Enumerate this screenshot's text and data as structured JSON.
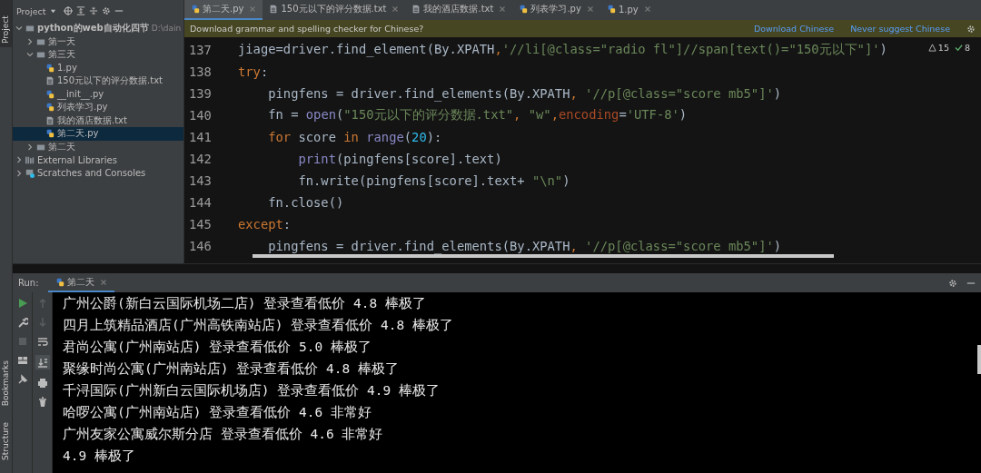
{
  "side_stripe": {
    "left_top": "Project",
    "left_bottom": [
      "Bookmarks",
      "Structure"
    ]
  },
  "project_panel": {
    "title": "Project",
    "tree": [
      {
        "label": "python的web自动化四节",
        "path": "D:\\dain",
        "kind": "folder",
        "expanded": true,
        "selected": false,
        "children": [
          {
            "label": "第一天",
            "kind": "folder",
            "expanded": false,
            "selected": false
          },
          {
            "label": "第三天",
            "kind": "folder",
            "expanded": true,
            "selected": false,
            "children": [
              {
                "label": "1.py",
                "kind": "py",
                "selected": false
              },
              {
                "label": "150元以下的评分数据.txt",
                "kind": "txt",
                "selected": false
              },
              {
                "label": "__init__.py",
                "kind": "py",
                "selected": false
              },
              {
                "label": "列表学习.py",
                "kind": "py",
                "selected": false
              },
              {
                "label": "我的酒店数据.txt",
                "kind": "txt",
                "selected": false
              },
              {
                "label": "第二天.py",
                "kind": "py",
                "selected": true
              }
            ]
          },
          {
            "label": "第二天",
            "kind": "folder",
            "expanded": false,
            "selected": false
          }
        ]
      },
      {
        "label": "External Libraries",
        "kind": "lib",
        "expanded": false,
        "selected": false
      },
      {
        "label": "Scratches and Consoles",
        "kind": "scratch",
        "expanded": false,
        "selected": false
      }
    ]
  },
  "editor_tabs": [
    {
      "label": "第二天.py",
      "kind": "py",
      "selected": true
    },
    {
      "label": "150元以下的评分数据.txt",
      "kind": "txt",
      "selected": false
    },
    {
      "label": "我的酒店数据.txt",
      "kind": "txt",
      "selected": false
    },
    {
      "label": "列表学习.py",
      "kind": "py",
      "selected": false
    },
    {
      "label": "1.py",
      "kind": "py",
      "selected": false
    }
  ],
  "notification": {
    "message": "Download grammar and spelling checker for Chinese?",
    "actions": [
      "Download Chinese",
      "Never suggest Chinese"
    ]
  },
  "inspections": {
    "warnings": "15",
    "ok": "8"
  },
  "code_lines": [
    {
      "number": "137",
      "tokens": [
        {
          "text": "jiage=driver.find_element(By.XPATH",
          "kind": "plain"
        },
        {
          "text": ",",
          "kind": "keyword"
        },
        {
          "text": "'//li[@class=\"radio fl\"]//span[text()=\"150元以下\"]'",
          "kind": "string"
        },
        {
          "text": ")",
          "kind": "plain"
        }
      ]
    },
    {
      "number": "138",
      "tokens": [
        {
          "text": "try",
          "kind": "keyword"
        },
        {
          "text": ":",
          "kind": "plain"
        }
      ]
    },
    {
      "number": "139",
      "tokens": [
        {
          "text": "    pingfens = driver.find_elements(By.XPATH",
          "kind": "plain"
        },
        {
          "text": ", ",
          "kind": "keyword"
        },
        {
          "text": "'//p[@class=\"score mb5\"]'",
          "kind": "string"
        },
        {
          "text": ")",
          "kind": "plain"
        }
      ]
    },
    {
      "number": "140",
      "tokens": [
        {
          "text": "    fn = ",
          "kind": "plain"
        },
        {
          "text": "open",
          "kind": "builtin"
        },
        {
          "text": "(",
          "kind": "plain"
        },
        {
          "text": "\"150元以下的评分数据.txt\"",
          "kind": "string"
        },
        {
          "text": ", ",
          "kind": "keyword"
        },
        {
          "text": "\"w\"",
          "kind": "string"
        },
        {
          "text": ",",
          "kind": "keyword"
        },
        {
          "text": "encoding",
          "kind": "param"
        },
        {
          "text": "=",
          "kind": "plain"
        },
        {
          "text": "'UTF-8'",
          "kind": "string"
        },
        {
          "text": ")",
          "kind": "plain"
        }
      ]
    },
    {
      "number": "141",
      "tokens": [
        {
          "text": "    for ",
          "kind": "keyword"
        },
        {
          "text": "score ",
          "kind": "plain"
        },
        {
          "text": "in ",
          "kind": "keyword"
        },
        {
          "text": "range",
          "kind": "builtin"
        },
        {
          "text": "(",
          "kind": "plain"
        },
        {
          "text": "20",
          "kind": "number"
        },
        {
          "text": "):",
          "kind": "plain"
        }
      ]
    },
    {
      "number": "142",
      "tokens": [
        {
          "text": "        print",
          "kind": "builtin"
        },
        {
          "text": "(pingfens[score].text)",
          "kind": "plain"
        }
      ]
    },
    {
      "number": "143",
      "tokens": [
        {
          "text": "        fn.write(pingfens[score].text+ ",
          "kind": "plain"
        },
        {
          "text": "\"\\n\"",
          "kind": "string"
        },
        {
          "text": ")",
          "kind": "plain"
        }
      ]
    },
    {
      "number": "144",
      "tokens": [
        {
          "text": "    fn.close()",
          "kind": "plain"
        }
      ]
    },
    {
      "number": "145",
      "tokens": [
        {
          "text": "except",
          "kind": "keyword"
        },
        {
          "text": ":",
          "kind": "plain"
        }
      ]
    },
    {
      "number": "146",
      "tokens": [
        {
          "text": "    pingfens = driver.find_elements(By.XPATH",
          "kind": "plain"
        },
        {
          "text": ", ",
          "kind": "keyword"
        },
        {
          "text": "'//p[@class=\"score mb5\"]'",
          "kind": "string"
        },
        {
          "text": ")",
          "kind": "plain"
        }
      ]
    }
  ],
  "run_panel": {
    "label": "Run:",
    "tab": "第二天"
  },
  "console_lines": [
    "广州公爵(新白云国际机场二店) 登录查看低价 4.8 棒极了",
    "四月上筑精品酒店(广州高铁南站店) 登录查看低价 4.8 棒极了",
    "君尚公寓(广州南站店) 登录查看低价 5.0 棒极了",
    "聚缘时尚公寓(广州南站店) 登录查看低价 4.8 棒极了",
    "千浔国际(广州新白云国际机场店) 登录查看低价 4.9 棒极了",
    "哈啰公寓(广州南站店) 登录查看低价 4.6 非常好",
    "广州友家公寓威尔斯分店 登录查看低价 4.6 非常好",
    "4.9 棒极了"
  ]
}
